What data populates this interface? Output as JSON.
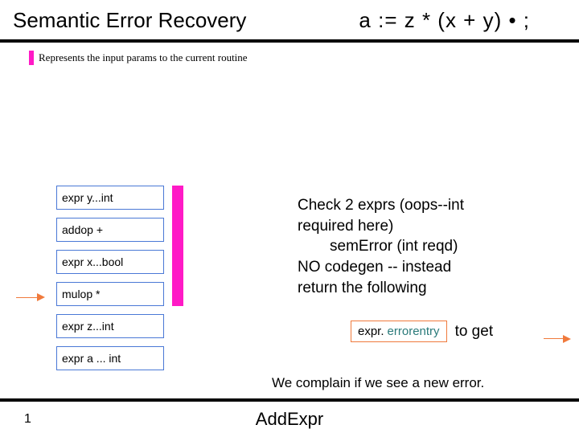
{
  "title": "Semantic Error Recovery",
  "expression": "a := z * (x + y) • ;",
  "legend": "Represents the input params to the current routine",
  "stack": [
    "expr y...int",
    "addop +",
    "expr x...bool",
    "mulop   *",
    "expr z...int",
    "expr a ... int"
  ],
  "right": {
    "l1": "Check 2 exprs (oops--int",
    "l2": "required here)",
    "l3": "semError (int reqd)",
    "l4": "NO codegen -- instead",
    "l5": " return the following"
  },
  "errbox": {
    "prefix": "expr.",
    "token": "errorentry"
  },
  "toget": "to get",
  "complain": "We complain if we see a new error.",
  "page": "1",
  "footer": "AddExpr"
}
